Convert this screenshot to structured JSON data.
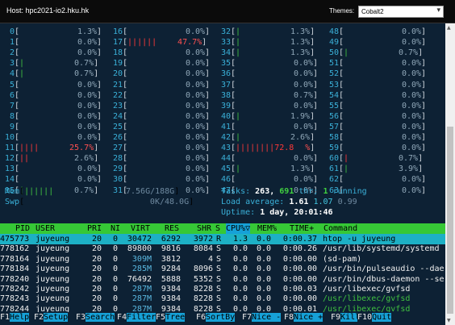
{
  "window": {
    "host_label": "Host: hpc2021-io2.hku.hk",
    "themes_label": "Themes:",
    "theme_value": "Cobalt2"
  },
  "cpus": {
    "col1": [
      {
        "num": "0",
        "bars": "",
        "pct": "1.3%"
      },
      {
        "num": "1",
        "bars": "",
        "pct": "0.0%"
      },
      {
        "num": "2",
        "bars": "",
        "pct": "0.0%"
      },
      {
        "num": "3",
        "bars": "|",
        "pct": "0.7%"
      },
      {
        "num": "4",
        "bars": "|",
        "pct": "0.7%"
      },
      {
        "num": "5",
        "bars": "",
        "pct": "0.0%"
      },
      {
        "num": "6",
        "bars": "",
        "pct": "0.0%"
      },
      {
        "num": "7",
        "bars": "",
        "pct": "0.0%"
      },
      {
        "num": "8",
        "bars": "",
        "pct": "0.0%"
      },
      {
        "num": "9",
        "bars": "",
        "pct": "0.0%"
      },
      {
        "num": "10",
        "bars": "",
        "pct": "0.0%"
      },
      {
        "num": "11",
        "bars": "||||",
        "pct": "25.7%"
      },
      {
        "num": "12",
        "bars": "||",
        "pct": "2.6%"
      },
      {
        "num": "13",
        "bars": "",
        "pct": "0.0%"
      },
      {
        "num": "14",
        "bars": "",
        "pct": "0.0%"
      },
      {
        "num": "15",
        "bars": "|",
        "pct": "0.7%"
      }
    ],
    "col2": [
      {
        "num": "16",
        "bars": "",
        "pct": "0.0%"
      },
      {
        "num": "17",
        "bars": "||||||",
        "pct": "47.7%"
      },
      {
        "num": "18",
        "bars": "",
        "pct": "0.0%"
      },
      {
        "num": "19",
        "bars": "",
        "pct": "0.0%"
      },
      {
        "num": "20",
        "bars": "",
        "pct": "0.0%"
      },
      {
        "num": "21",
        "bars": "",
        "pct": "0.0%"
      },
      {
        "num": "22",
        "bars": "",
        "pct": "0.0%"
      },
      {
        "num": "23",
        "bars": "",
        "pct": "0.0%"
      },
      {
        "num": "24",
        "bars": "",
        "pct": "0.0%"
      },
      {
        "num": "25",
        "bars": "",
        "pct": "0.0%"
      },
      {
        "num": "26",
        "bars": "",
        "pct": "0.0%"
      },
      {
        "num": "27",
        "bars": "",
        "pct": "0.0%"
      },
      {
        "num": "28",
        "bars": "",
        "pct": "0.0%"
      },
      {
        "num": "29",
        "bars": "",
        "pct": "0.0%"
      },
      {
        "num": "30",
        "bars": "",
        "pct": "0.0%"
      },
      {
        "num": "31",
        "bars": "",
        "pct": "0.0%"
      }
    ],
    "col3": [
      {
        "num": "32",
        "bars": "|",
        "pct": "1.3%"
      },
      {
        "num": "33",
        "bars": "|",
        "pct": "1.3%"
      },
      {
        "num": "34",
        "bars": "|",
        "pct": "1.3%"
      },
      {
        "num": "35",
        "bars": "",
        "pct": "0.0%"
      },
      {
        "num": "36",
        "bars": "",
        "pct": "0.0%"
      },
      {
        "num": "37",
        "bars": "",
        "pct": "0.0%"
      },
      {
        "num": "38",
        "bars": "",
        "pct": "0.7%"
      },
      {
        "num": "39",
        "bars": "",
        "pct": "0.0%"
      },
      {
        "num": "40",
        "bars": "|",
        "pct": "1.9%"
      },
      {
        "num": "41",
        "bars": "",
        "pct": "0.0%"
      },
      {
        "num": "42",
        "bars": "|",
        "pct": "2.6%"
      },
      {
        "num": "43",
        "bars": "||||||||72.8",
        "pct": "%"
      },
      {
        "num": "44",
        "bars": "",
        "pct": "0.0%"
      },
      {
        "num": "45",
        "bars": "|",
        "pct": "1.3%"
      },
      {
        "num": "46",
        "bars": "",
        "pct": "0.0%"
      },
      {
        "num": "47",
        "bars": "",
        "pct": "0.0%"
      }
    ],
    "col4": [
      {
        "num": "48",
        "bars": "",
        "pct": "0.0%"
      },
      {
        "num": "49",
        "bars": "",
        "pct": "0.0%"
      },
      {
        "num": "50",
        "bars": "|",
        "pct": "0.7%"
      },
      {
        "num": "51",
        "bars": "",
        "pct": "0.0%"
      },
      {
        "num": "52",
        "bars": "",
        "pct": "0.0%"
      },
      {
        "num": "53",
        "bars": "",
        "pct": "0.0%"
      },
      {
        "num": "54",
        "bars": "",
        "pct": "0.0%"
      },
      {
        "num": "55",
        "bars": "",
        "pct": "0.0%"
      },
      {
        "num": "56",
        "bars": "",
        "pct": "0.0%"
      },
      {
        "num": "57",
        "bars": "",
        "pct": "0.0%"
      },
      {
        "num": "58",
        "bars": "",
        "pct": "0.0%"
      },
      {
        "num": "59",
        "bars": "",
        "pct": "0.0%"
      },
      {
        "num": "60",
        "bars": "|",
        "pct": "0.7%"
      },
      {
        "num": "61",
        "bars": "|",
        "pct": "3.9%"
      },
      {
        "num": "62",
        "bars": "",
        "pct": "0.0%"
      },
      {
        "num": "63",
        "bars": "",
        "pct": "0.0%"
      }
    ]
  },
  "memory": {
    "mem_label": "Mem",
    "mem_bars": "||||||",
    "mem_value": "7.56G/188G",
    "swp_label": "Swp",
    "swp_value": "0K/48.0G"
  },
  "summary": {
    "tasks_label": "Tasks:",
    "tasks": "263,",
    "threads": "691",
    "thr_label": "thr;",
    "running": "1",
    "running_label": "running",
    "load_label": "Load average:",
    "load1": "1.61",
    "load5": "1.07",
    "load15": "0.99",
    "uptime_label": "Uptime:",
    "uptime_value": "1 day, 20:01:46"
  },
  "table": {
    "headers": [
      "PID",
      "USER",
      "PRI",
      "NI",
      "VIRT",
      "RES",
      "SHR",
      "S",
      "CPU%▽",
      "MEM%",
      "TIME+",
      "Command"
    ],
    "rows": [
      {
        "pid": "475773",
        "user": "juyeung",
        "pri": "20",
        "ni": "0",
        "virt": "30472",
        "res": "6292",
        "shr": "3972",
        "s": "R",
        "cpu": "1.3",
        "mem": "0.0",
        "time": "0:00.37",
        "cmd": "htop -u juyeung"
      },
      {
        "pid": "778162",
        "user": "juyeung",
        "pri": "20",
        "ni": "0",
        "virt": "89800",
        "res": "9816",
        "shr": "8084",
        "s": "S",
        "cpu": "0.0",
        "mem": "0.0",
        "time": "0:00.26",
        "cmd": "/usr/lib/systemd/systemd"
      },
      {
        "pid": "778164",
        "user": "juyeung",
        "pri": "20",
        "ni": "0",
        "virt": "309M",
        "res": "3812",
        "shr": "4",
        "s": "S",
        "cpu": "0.0",
        "mem": "0.0",
        "time": "0:00.00",
        "cmd": "(sd-pam)"
      },
      {
        "pid": "778184",
        "user": "juyeung",
        "pri": "20",
        "ni": "0",
        "virt": "285M",
        "res": "9284",
        "shr": "8096",
        "s": "S",
        "cpu": "0.0",
        "mem": "0.0",
        "time": "0:00.00",
        "cmd": "/usr/bin/pulseaudio --dae"
      },
      {
        "pid": "778240",
        "user": "juyeung",
        "pri": "20",
        "ni": "0",
        "virt": "76492",
        "res": "5888",
        "shr": "5352",
        "s": "S",
        "cpu": "0.0",
        "mem": "0.0",
        "time": "0:00.00",
        "cmd": "/usr/bin/dbus-daemon --se"
      },
      {
        "pid": "778242",
        "user": "juyeung",
        "pri": "20",
        "ni": "0",
        "virt": "287M",
        "res": "9384",
        "shr": "8228",
        "s": "S",
        "cpu": "0.0",
        "mem": "0.0",
        "time": "0:00.03",
        "cmd": "/usr/libexec/gvfsd"
      },
      {
        "pid": "778243",
        "user": "juyeung",
        "pri": "20",
        "ni": "0",
        "virt": "287M",
        "res": "9384",
        "shr": "8228",
        "s": "S",
        "cpu": "0.0",
        "mem": "0.0",
        "time": "0:00.00",
        "cmd": "/usr/libexec/gvfsd"
      },
      {
        "pid": "778244",
        "user": "juyeung",
        "pri": "20",
        "ni": "0",
        "virt": "287M",
        "res": "9384",
        "shr": "8228",
        "s": "S",
        "cpu": "0.0",
        "mem": "0.0",
        "time": "0:00.01",
        "cmd": "/usr/libexec/gvfsd"
      }
    ]
  },
  "fkeys": [
    {
      "key": "F1",
      "label": "Help"
    },
    {
      "key": "F2",
      "label": "Setup"
    },
    {
      "key": "F3",
      "label": "Search"
    },
    {
      "key": "F4",
      "label": "Filter"
    },
    {
      "key": "F5",
      "label": "Tree"
    },
    {
      "key": "F6",
      "label": "SortBy"
    },
    {
      "key": "F7",
      "label": "Nice -"
    },
    {
      "key": "F8",
      "label": "Nice +"
    },
    {
      "key": "F9",
      "label": "Kill"
    },
    {
      "key": "F10",
      "label": "Quit"
    }
  ]
}
